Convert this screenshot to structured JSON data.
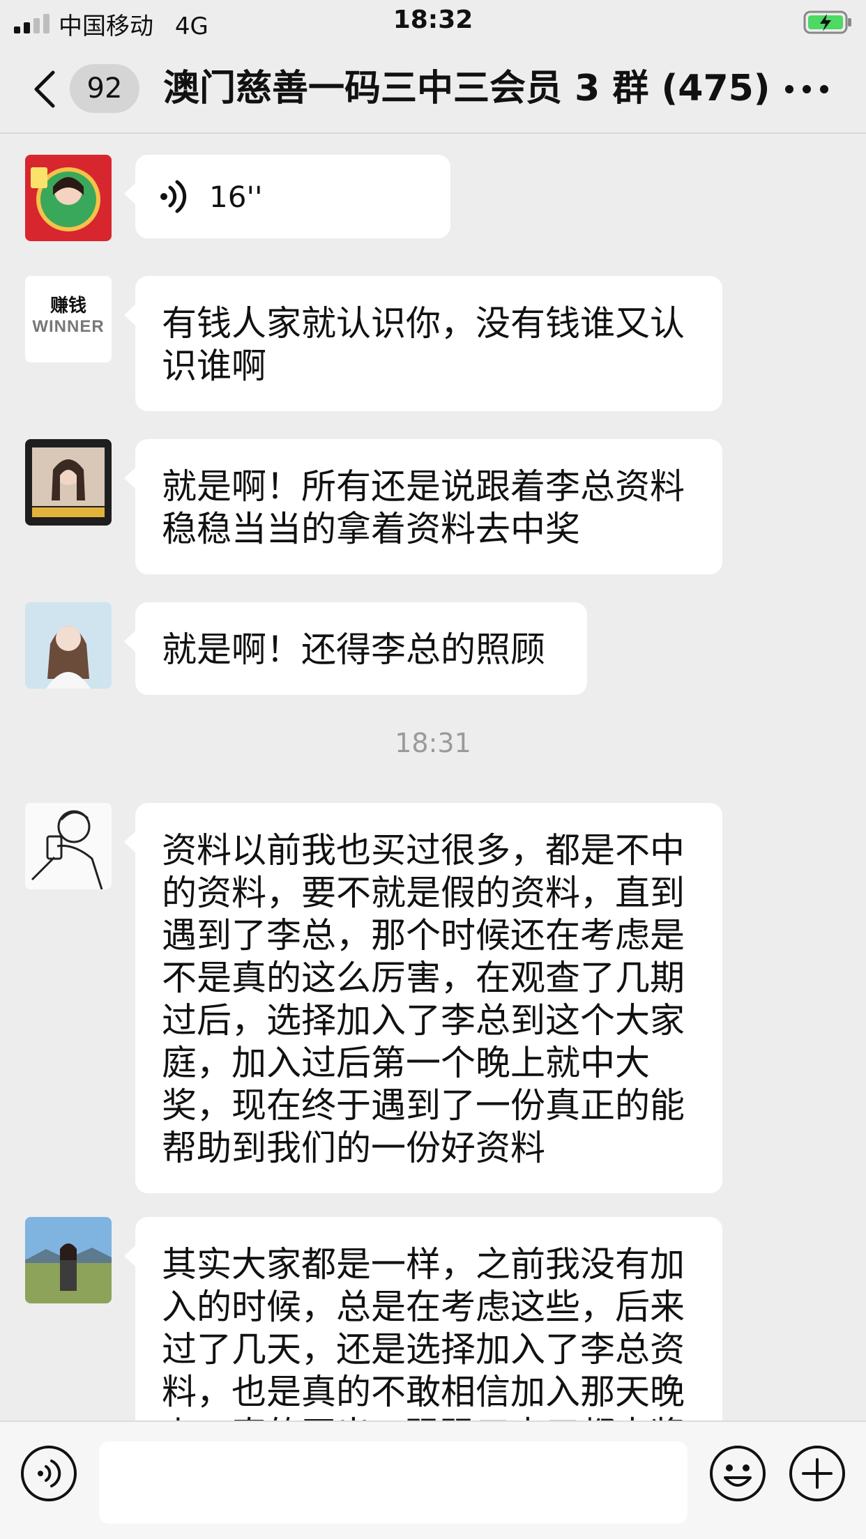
{
  "status_bar": {
    "carrier": "中国移动",
    "network": "4G",
    "time": "18:32",
    "icons": [
      "signal-icon",
      "battery-charging-icon"
    ]
  },
  "header": {
    "back_icon": "chevron-left-icon",
    "unread_count": "92",
    "title": "澳门慈善一码三中三会员 3 群 (475)",
    "more_icon": "more-icon"
  },
  "messages": [
    {
      "type": "voice",
      "duration": "16''",
      "avatar": "avatar-red-frame"
    },
    {
      "type": "text",
      "text": "有钱人家就认识你，没有钱谁又认识谁啊",
      "avatar": "avatar-winner",
      "avatar_text": [
        "赚钱",
        "WINNER"
      ]
    },
    {
      "type": "text",
      "text": "就是啊！所有还是说跟着李总资料稳稳当当的拿着资料去中奖",
      "avatar": "avatar-photo-frame"
    },
    {
      "type": "text",
      "text": "就是啊！还得李总的照顾",
      "avatar": "avatar-woman-light"
    },
    {
      "type": "time",
      "text": "18:31"
    },
    {
      "type": "text",
      "text": "资料以前我也买过很多，都是不中的资料，要不就是假的资料，直到遇到了李总，那个时候还在考虑是不是真的这么厉害，在观查了几期过后，选择加入了李总到这个大家庭，加入过后第一个晚上就中大奖，现在终于遇到了一份真正的能帮助到我们的一份好资料",
      "avatar": "avatar-sketch"
    },
    {
      "type": "text",
      "text": "其实大家都是一样，之前我没有加入的时候，总是在考虑这些，后来过了几天，还是选择加入了李总资料，也是真的不敢相信加入那天晚上，真的开出，码码三中三都中奖",
      "avatar": "avatar-outdoor"
    }
  ],
  "input_bar": {
    "voice_icon": "voice-input-icon",
    "emoji_icon": "emoji-icon",
    "plus_icon": "plus-icon",
    "value": ""
  },
  "colors": {
    "background": "#ededed",
    "bubble": "#ffffff",
    "timestamp": "#9a9a9a",
    "battery": "#4cd964"
  }
}
